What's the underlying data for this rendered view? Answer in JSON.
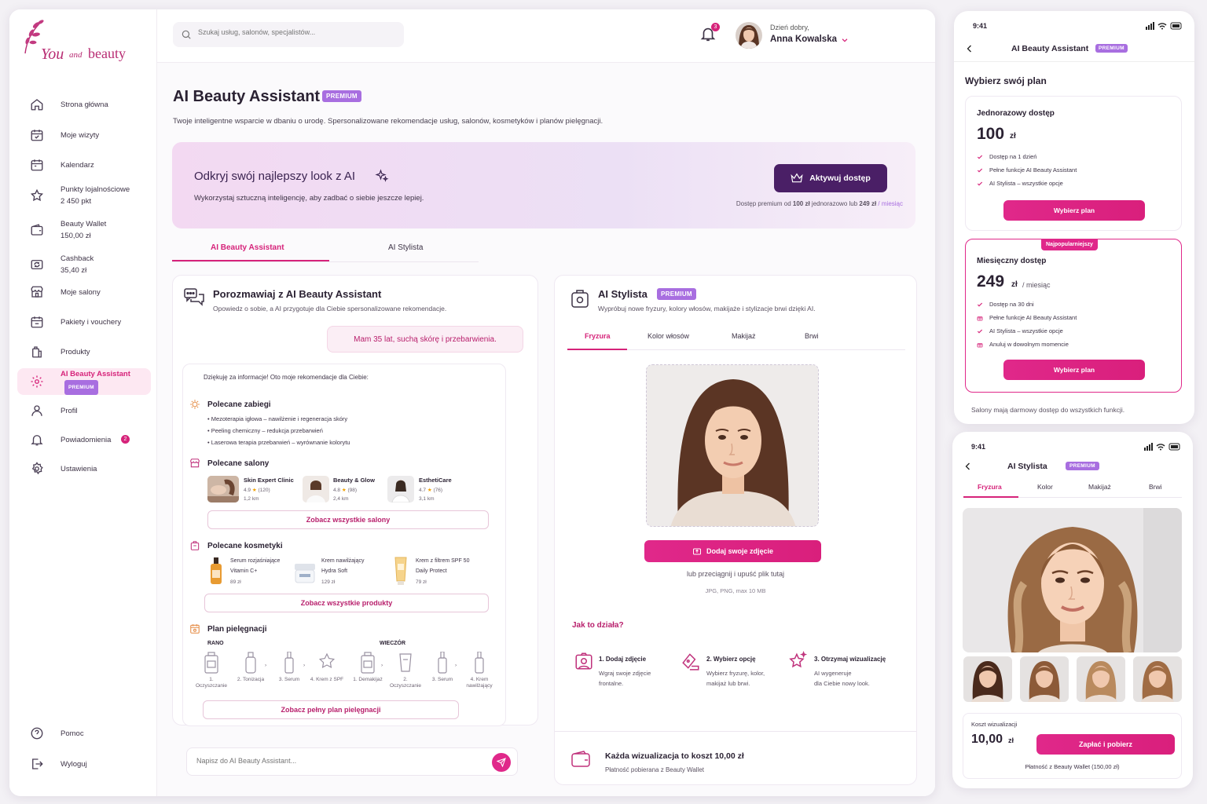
{
  "brand": {
    "you": "You",
    "and": "and",
    "beauty": "beauty"
  },
  "sidebar": {
    "items": [
      {
        "label": "Strona główna",
        "icon": "home-icon"
      },
      {
        "label": "Moje wizyty",
        "icon": "calendar-check-icon"
      },
      {
        "label": "Kalendarz",
        "icon": "calendar-icon"
      },
      {
        "label": "Punkty lojalnościowe",
        "sub": "2 450 pkt",
        "icon": "star-icon"
      },
      {
        "label": "Beauty Wallet",
        "sub": "150,00 zł",
        "icon": "wallet-icon"
      },
      {
        "label": "Cashback",
        "sub": "35,40 zł",
        "icon": "cashback-icon"
      },
      {
        "label": "Moje salony",
        "icon": "store-icon"
      },
      {
        "label": "Pakiety i vouchery",
        "icon": "voucher-icon"
      },
      {
        "label": "Produkty",
        "icon": "bag-icon"
      },
      {
        "label": "AI Beauty Assistant",
        "badge": "PREMIUM",
        "icon": "ai-gear-icon"
      },
      {
        "label": "Profil",
        "icon": "user-icon"
      },
      {
        "label": "Powiadomienia",
        "count": "2",
        "icon": "bell-icon"
      },
      {
        "label": "Ustawienia",
        "icon": "settings-icon"
      }
    ],
    "bottom": [
      {
        "label": "Pomoc",
        "icon": "help-icon"
      },
      {
        "label": "Wyloguj",
        "icon": "logout-icon"
      }
    ]
  },
  "header": {
    "search_placeholder": "Szukaj usług, salonów, specjalistów...",
    "notif_count": "3",
    "greeting": "Dzień dobry,",
    "user": "Anna Kowalska"
  },
  "page": {
    "title": "AI Beauty Assistant",
    "badge": "PREMIUM",
    "subtitle": "Twoje inteligentne wsparcie w dbaniu o urodę. Spersonalizowane rekomendacje usług, salonów, kosmetyków i planów pielęgnacji."
  },
  "hero": {
    "heading": "Odkryj swój najlepszy look z AI",
    "text": "Wykorzystaj sztuczną inteligencję, aby zadbać o siebie jeszcze lepiej.",
    "button": "Aktywuj dostęp",
    "note_a": "Dostęp premium od ",
    "note_b": "100 zł",
    "note_c": " jednorazowo lub ",
    "note_d": "249 zł",
    "note_e": " / miesiąc"
  },
  "tabs": [
    "AI Beauty Assistant",
    "AI Stylista"
  ],
  "chat": {
    "title": "Porozmawiaj z AI Beauty Assistant",
    "subtitle": "Opowiedz o sobie, a AI przygotuje dla Ciebie spersonalizowane rekomendacje.",
    "user_msg": "Mam 35 lat, suchą skórę i przebarwienia.",
    "reply_intro": "Dziękuję za informacje! Oto moje rekomendacje dla Ciebie:",
    "treatments_h": "Polecane zabiegi",
    "treatments": [
      "• Mezoterapia igłowa – nawilżenie i regeneracja skóry",
      "• Peeling chemiczny – redukcja przebarwień",
      "• Laserowa terapia przebarwień – wyrównanie kolorytu"
    ],
    "salons_h": "Polecane salony",
    "salons": [
      {
        "name": "Skin Expert Clinic",
        "rating": "4.9",
        "reviews": "(120)",
        "dist": "1,2 km"
      },
      {
        "name": "Beauty & Glow",
        "rating": "4.8",
        "reviews": "(98)",
        "dist": "2,4 km"
      },
      {
        "name": "EsthetiCare",
        "rating": "4.7",
        "reviews": "(76)",
        "dist": "3,1 km"
      }
    ],
    "salons_btn": "Zobacz wszystkie salony",
    "cosm_h": "Polecane kosmetyki",
    "cosmetics": [
      {
        "l1": "Serum rozjaśniające",
        "l2": "Vitamin C+",
        "price": "89 zł"
      },
      {
        "l1": "Krem nawilżający",
        "l2": "Hydra Soft",
        "price": "129 zł"
      },
      {
        "l1": "Krem z filtrem SPF 50",
        "l2": "Daily Protect",
        "price": "79 zł"
      }
    ],
    "cosm_btn": "Zobacz wszystkie produkty",
    "plan_h": "Plan pielęgnacji",
    "morning": "RANO",
    "evening": "WIECZÓR",
    "morning_steps": [
      "1. Oczyszczanie",
      "2. Tonizacja",
      "3. Serum",
      "4. Krem z SPF"
    ],
    "evening_steps": [
      "1. Demakijaż",
      "2. Oczyszczanie",
      "3. Serum",
      "4. Krem nawilżający"
    ],
    "plan_btn": "Zobacz pełny plan pielęgnacji",
    "input_placeholder": "Napisz do AI Beauty Assistant..."
  },
  "stylist": {
    "title": "AI Stylista",
    "badge": "PREMIUM",
    "subtitle": "Wypróbuj nowe fryzury, kolory włosów, makijaże i stylizacje brwi dzięki AI.",
    "tabs": [
      "Fryzura",
      "Kolor włosów",
      "Makijaż",
      "Brwi"
    ],
    "upload_btn": "Dodaj swoje zdjęcie",
    "drag": "lub przeciągnij i upuść plik tutaj",
    "formats": "JPG, PNG, max 10 MB",
    "how_h": "Jak to działa?",
    "steps": [
      {
        "t": "1. Dodaj zdjęcie",
        "d1": "Wgraj swoje zdjęcie",
        "d2": "frontalne."
      },
      {
        "t": "2. Wybierz opcję",
        "d1": "Wybierz fryzurę, kolor,",
        "d2": "makijaż lub brwi."
      },
      {
        "t": "3. Otrzymaj wizualizację",
        "d1": "AI wygeneruje",
        "d2": "dla Ciebie nowy look."
      }
    ],
    "cost_h": "Każda wizualizacja to koszt 10,00 zł",
    "cost_sub": "Płatność pobierana z Beauty Wallet"
  },
  "phone1": {
    "time": "9:41",
    "title": "AI Beauty Assistant",
    "badge": "PREMIUM",
    "heading": "Wybierz swój plan",
    "plan1": {
      "name": "Jednorazowy dostęp",
      "price": "100",
      "cur": "zł",
      "features": [
        "Dostęp na 1 dzień",
        "Pełne funkcje AI Beauty Assistant",
        "AI Stylista – wszystkie opcje"
      ],
      "btn": "Wybierz plan"
    },
    "plan2": {
      "tag": "Najpopularniejszy",
      "name": "Miesięczny dostęp",
      "price": "249",
      "cur": "zł",
      "per": "/ miesiąc",
      "features": [
        "Dostęp na 30 dni",
        "Pełne funkcje AI Beauty Assistant",
        "AI Stylista – wszystkie opcje",
        "Anuluj w dowolnym momencie"
      ],
      "btn": "Wybierz plan"
    },
    "footer": "Salony mają darmowy dostęp do wszystkich funkcji."
  },
  "phone2": {
    "time": "9:41",
    "title": "AI Stylista",
    "badge": "PREMIUM",
    "tabs": [
      "Fryzura",
      "Kolor",
      "Makijaż",
      "Brwi"
    ],
    "cost_label": "Koszt wizualizacji",
    "cost": "10,00",
    "cur": "zł",
    "pay_btn": "Zapłać i pobierz",
    "pay_note": "Płatność z Beauty Wallet (150,00 zł)"
  },
  "colors": {
    "accent": "#d6237a",
    "dark": "#4a1f66",
    "premium": "#a86ee0"
  }
}
